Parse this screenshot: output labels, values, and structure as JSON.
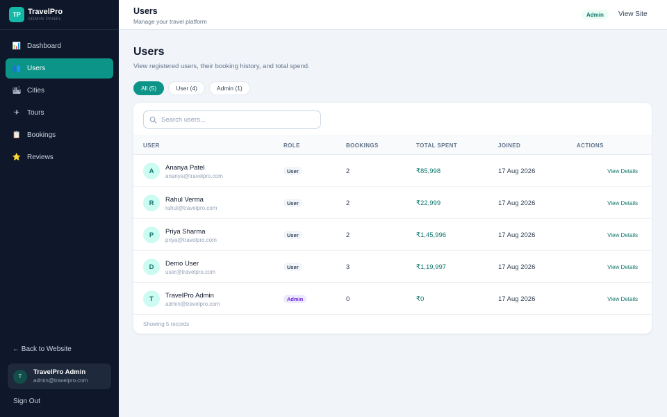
{
  "brand": {
    "logo": "TP",
    "title": "TravelPro",
    "subtitle": "ADMIN PANEL"
  },
  "sidebar": {
    "items": [
      {
        "label": "Dashboard",
        "icon": "📊",
        "icon_name": "dashboard-icon",
        "active": false
      },
      {
        "label": "Users",
        "icon": "👥",
        "icon_name": "users-icon",
        "active": true
      },
      {
        "label": "Cities",
        "icon": "🏙",
        "icon_name": "cities-icon",
        "active": false
      },
      {
        "label": "Tours",
        "icon": "✈",
        "icon_name": "tours-icon",
        "active": false
      },
      {
        "label": "Bookings",
        "icon": "📋",
        "icon_name": "bookings-icon",
        "active": false
      },
      {
        "label": "Reviews",
        "icon": "⭐",
        "icon_name": "reviews-icon",
        "active": false
      }
    ],
    "back_link": "← Back to Website",
    "current_user": {
      "initial": "T",
      "name": "TravelPro Admin",
      "email": "admin@travelpro.com"
    },
    "sign_out": "Sign Out"
  },
  "topbar": {
    "title": "Users",
    "subtitle": "Manage your travel platform",
    "role_badge": "Admin",
    "view_site": "View Site"
  },
  "main": {
    "title": "Users",
    "subtitle": "View registered users, their booking history, and total spend.",
    "filters": [
      {
        "label": "All (5)",
        "active": true
      },
      {
        "label": "User (4)",
        "active": false
      },
      {
        "label": "Admin (1)",
        "active": false
      }
    ],
    "search_placeholder": "Search users...",
    "columns": {
      "user": "USER",
      "role": "ROLE",
      "bookings": "BOOKINGS",
      "total_spent": "TOTAL SPENT",
      "joined": "JOINED",
      "actions": "ACTIONS"
    },
    "rows": [
      {
        "initial": "A",
        "name": "Ananya Patel",
        "email": "ananya@travelpro.com",
        "role": "User",
        "bookings": "2",
        "total_spent": "₹85,998",
        "joined": "17 Aug 2026",
        "action": "View Details"
      },
      {
        "initial": "R",
        "name": "Rahul Verma",
        "email": "rahul@travelpro.com",
        "role": "User",
        "bookings": "2",
        "total_spent": "₹22,999",
        "joined": "17 Aug 2026",
        "action": "View Details"
      },
      {
        "initial": "P",
        "name": "Priya Sharma",
        "email": "priya@travelpro.com",
        "role": "User",
        "bookings": "2",
        "total_spent": "₹1,45,996",
        "joined": "17 Aug 2026",
        "action": "View Details"
      },
      {
        "initial": "D",
        "name": "Demo User",
        "email": "user@travelpro.com",
        "role": "User",
        "bookings": "3",
        "total_spent": "₹1,19,997",
        "joined": "17 Aug 2026",
        "action": "View Details"
      },
      {
        "initial": "T",
        "name": "TravelPro Admin",
        "email": "admin@travelpro.com",
        "role": "Admin",
        "bookings": "0",
        "total_spent": "₹0",
        "joined": "17 Aug 2026",
        "action": "View Details"
      }
    ],
    "footer": "Showing 5 records"
  },
  "colors": {
    "accent": "#0d9488",
    "sidebar_bg": "#0f172a",
    "admin_badge": "#6d28d9"
  }
}
